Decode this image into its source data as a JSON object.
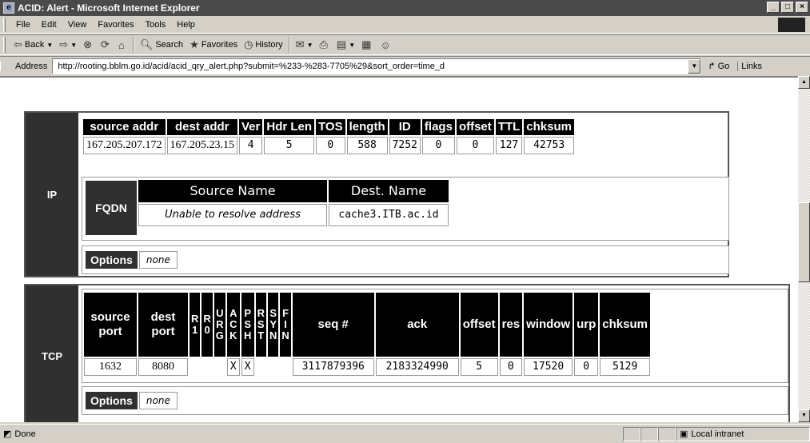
{
  "window": {
    "title": "ACID: Alert - Microsoft Internet Explorer"
  },
  "menu": [
    "File",
    "Edit",
    "View",
    "Favorites",
    "Tools",
    "Help"
  ],
  "toolbar": {
    "back": "Back",
    "search": "Search",
    "favorites": "Favorites",
    "history": "History"
  },
  "address": {
    "label": "Address",
    "url": "http://rooting.bblm.go.id/acid/acid_qry_alert.php?submit=%233-%283-7705%29&sort_order=time_d",
    "go": "Go",
    "links": "Links"
  },
  "ip": {
    "label": "IP",
    "headers": [
      "source addr",
      "dest addr",
      "Ver",
      "Hdr Len",
      "TOS",
      "length",
      "ID",
      "flags",
      "offset",
      "TTL",
      "chksum"
    ],
    "values": [
      "167.205.207.172",
      "167.205.23.15",
      "4",
      "5",
      "0",
      "588",
      "7252",
      "0",
      "0",
      "127",
      "42753"
    ],
    "fqdn": {
      "label": "FQDN",
      "headers": [
        "Source Name",
        "Dest. Name"
      ],
      "values": [
        "Unable to resolve address",
        "cache3.ITB.ac.id"
      ]
    },
    "options": {
      "label": "Options",
      "value": "none"
    }
  },
  "tcp": {
    "label": "TCP",
    "h_source": "source port",
    "h_dest": "dest port",
    "flags": [
      "R\n1",
      "R\n0",
      "U\nR\nG",
      "A\nC\nK",
      "P\nS\nH",
      "R\nS\nT",
      "S\nY\nN",
      "F\nI\nN"
    ],
    "h_rest": [
      "seq #",
      "ack",
      "offset",
      "res",
      "window",
      "urp",
      "chksum"
    ],
    "v_source": "1632",
    "v_dest": "8080",
    "flag_values": [
      "",
      "",
      "",
      "X",
      "X",
      "",
      "",
      ""
    ],
    "v_rest": [
      "3117879396",
      "2183324990",
      "5",
      "0",
      "17520",
      "0",
      "5129"
    ],
    "options": {
      "label": "Options",
      "value": "none"
    }
  },
  "status": {
    "text": "Done",
    "zone": "Local intranet"
  }
}
